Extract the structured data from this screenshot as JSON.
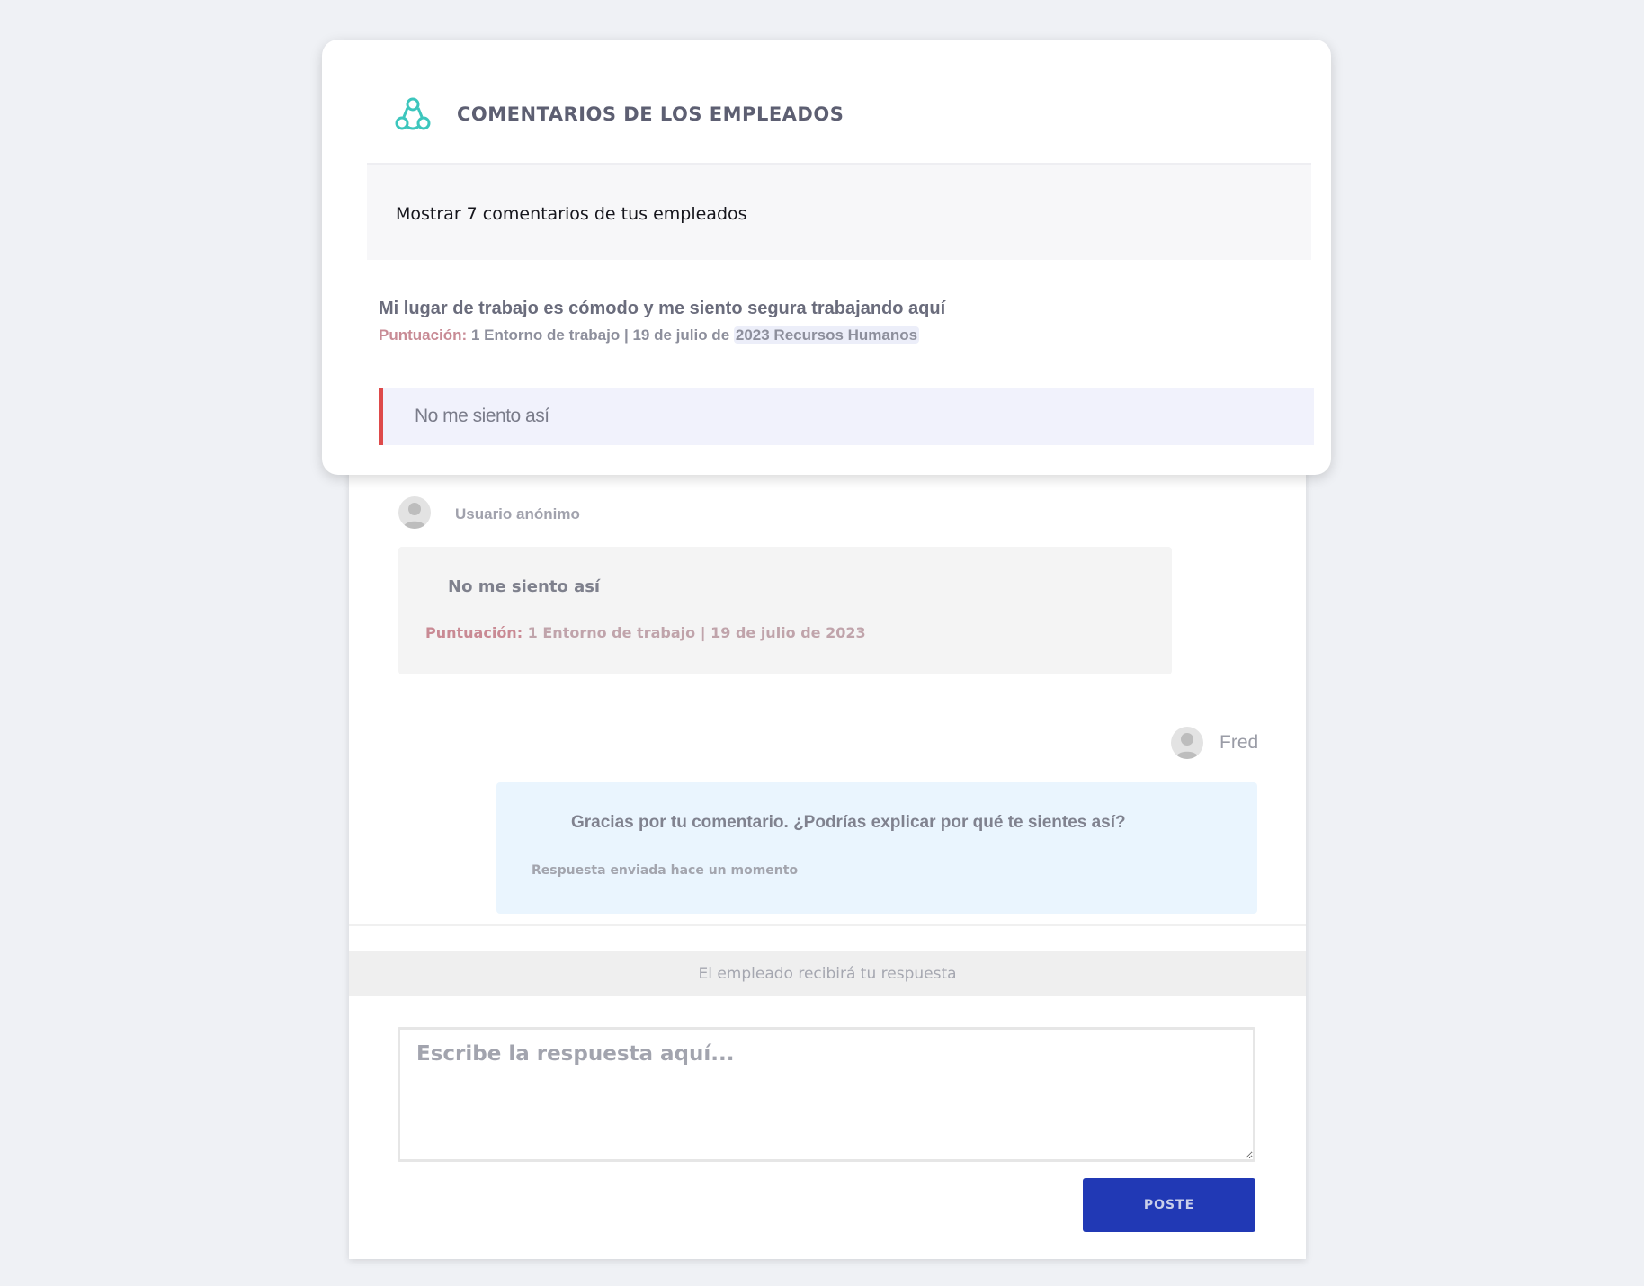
{
  "header": {
    "title": "COMENTARIOS DE LOS EMPLEADOS",
    "icon": "team-network-icon",
    "icon_color": "#3cc6bd"
  },
  "show_comments": "Mostrar 7 comentarios de tus empleados",
  "question": {
    "text": "Mi lugar de trabajo es cómodo y me siento segura trabajando aquí",
    "score_label": "Puntuación:",
    "meta": "1 Entorno de trabajo | 19 de julio de",
    "department": "2023 Recursos Humanos",
    "answer": "No me siento así",
    "accent_color": "#de4a4a"
  },
  "conversation": {
    "anonymous": {
      "name": "Usuario anónimo",
      "message": "No me siento así",
      "score_label": "Puntuación:",
      "meta": "1 Entorno de trabajo | 19 de julio de 2023"
    },
    "reply": {
      "name": "Fred",
      "message": "Gracias por tu comentario. ¿Podrías explicar por qué te sientes así?",
      "status": "Respuesta enviada hace un momento"
    }
  },
  "notice": "El empleado recibirá tu respuesta",
  "reply_form": {
    "placeholder": "Escribe la respuesta aquí...",
    "value": "",
    "submit_label": "POSTE",
    "submit_color": "#2139b5"
  }
}
